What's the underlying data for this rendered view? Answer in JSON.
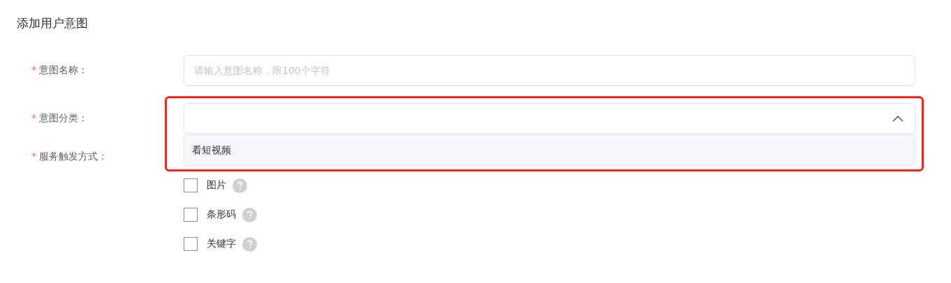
{
  "title": "添加用户意图",
  "fields": [
    {
      "kind": "input",
      "label": "意图名称：",
      "required_mark": "*",
      "placeholder": "请输入意图名称，限100个字符"
    },
    {
      "kind": "select",
      "label": "意图分类：",
      "required_mark": "*",
      "expanded": true,
      "options": [
        {
          "label": "看短视频",
          "selected": false
        }
      ]
    },
    {
      "kind": "checkboxes",
      "label": "服务触发方式：",
      "required_mark": "*",
      "options": [
        {
          "label": "图片",
          "checked": false
        },
        {
          "label": "条形码",
          "checked": false
        },
        {
          "label": "关键字",
          "checked": false
        }
      ]
    }
  ]
}
